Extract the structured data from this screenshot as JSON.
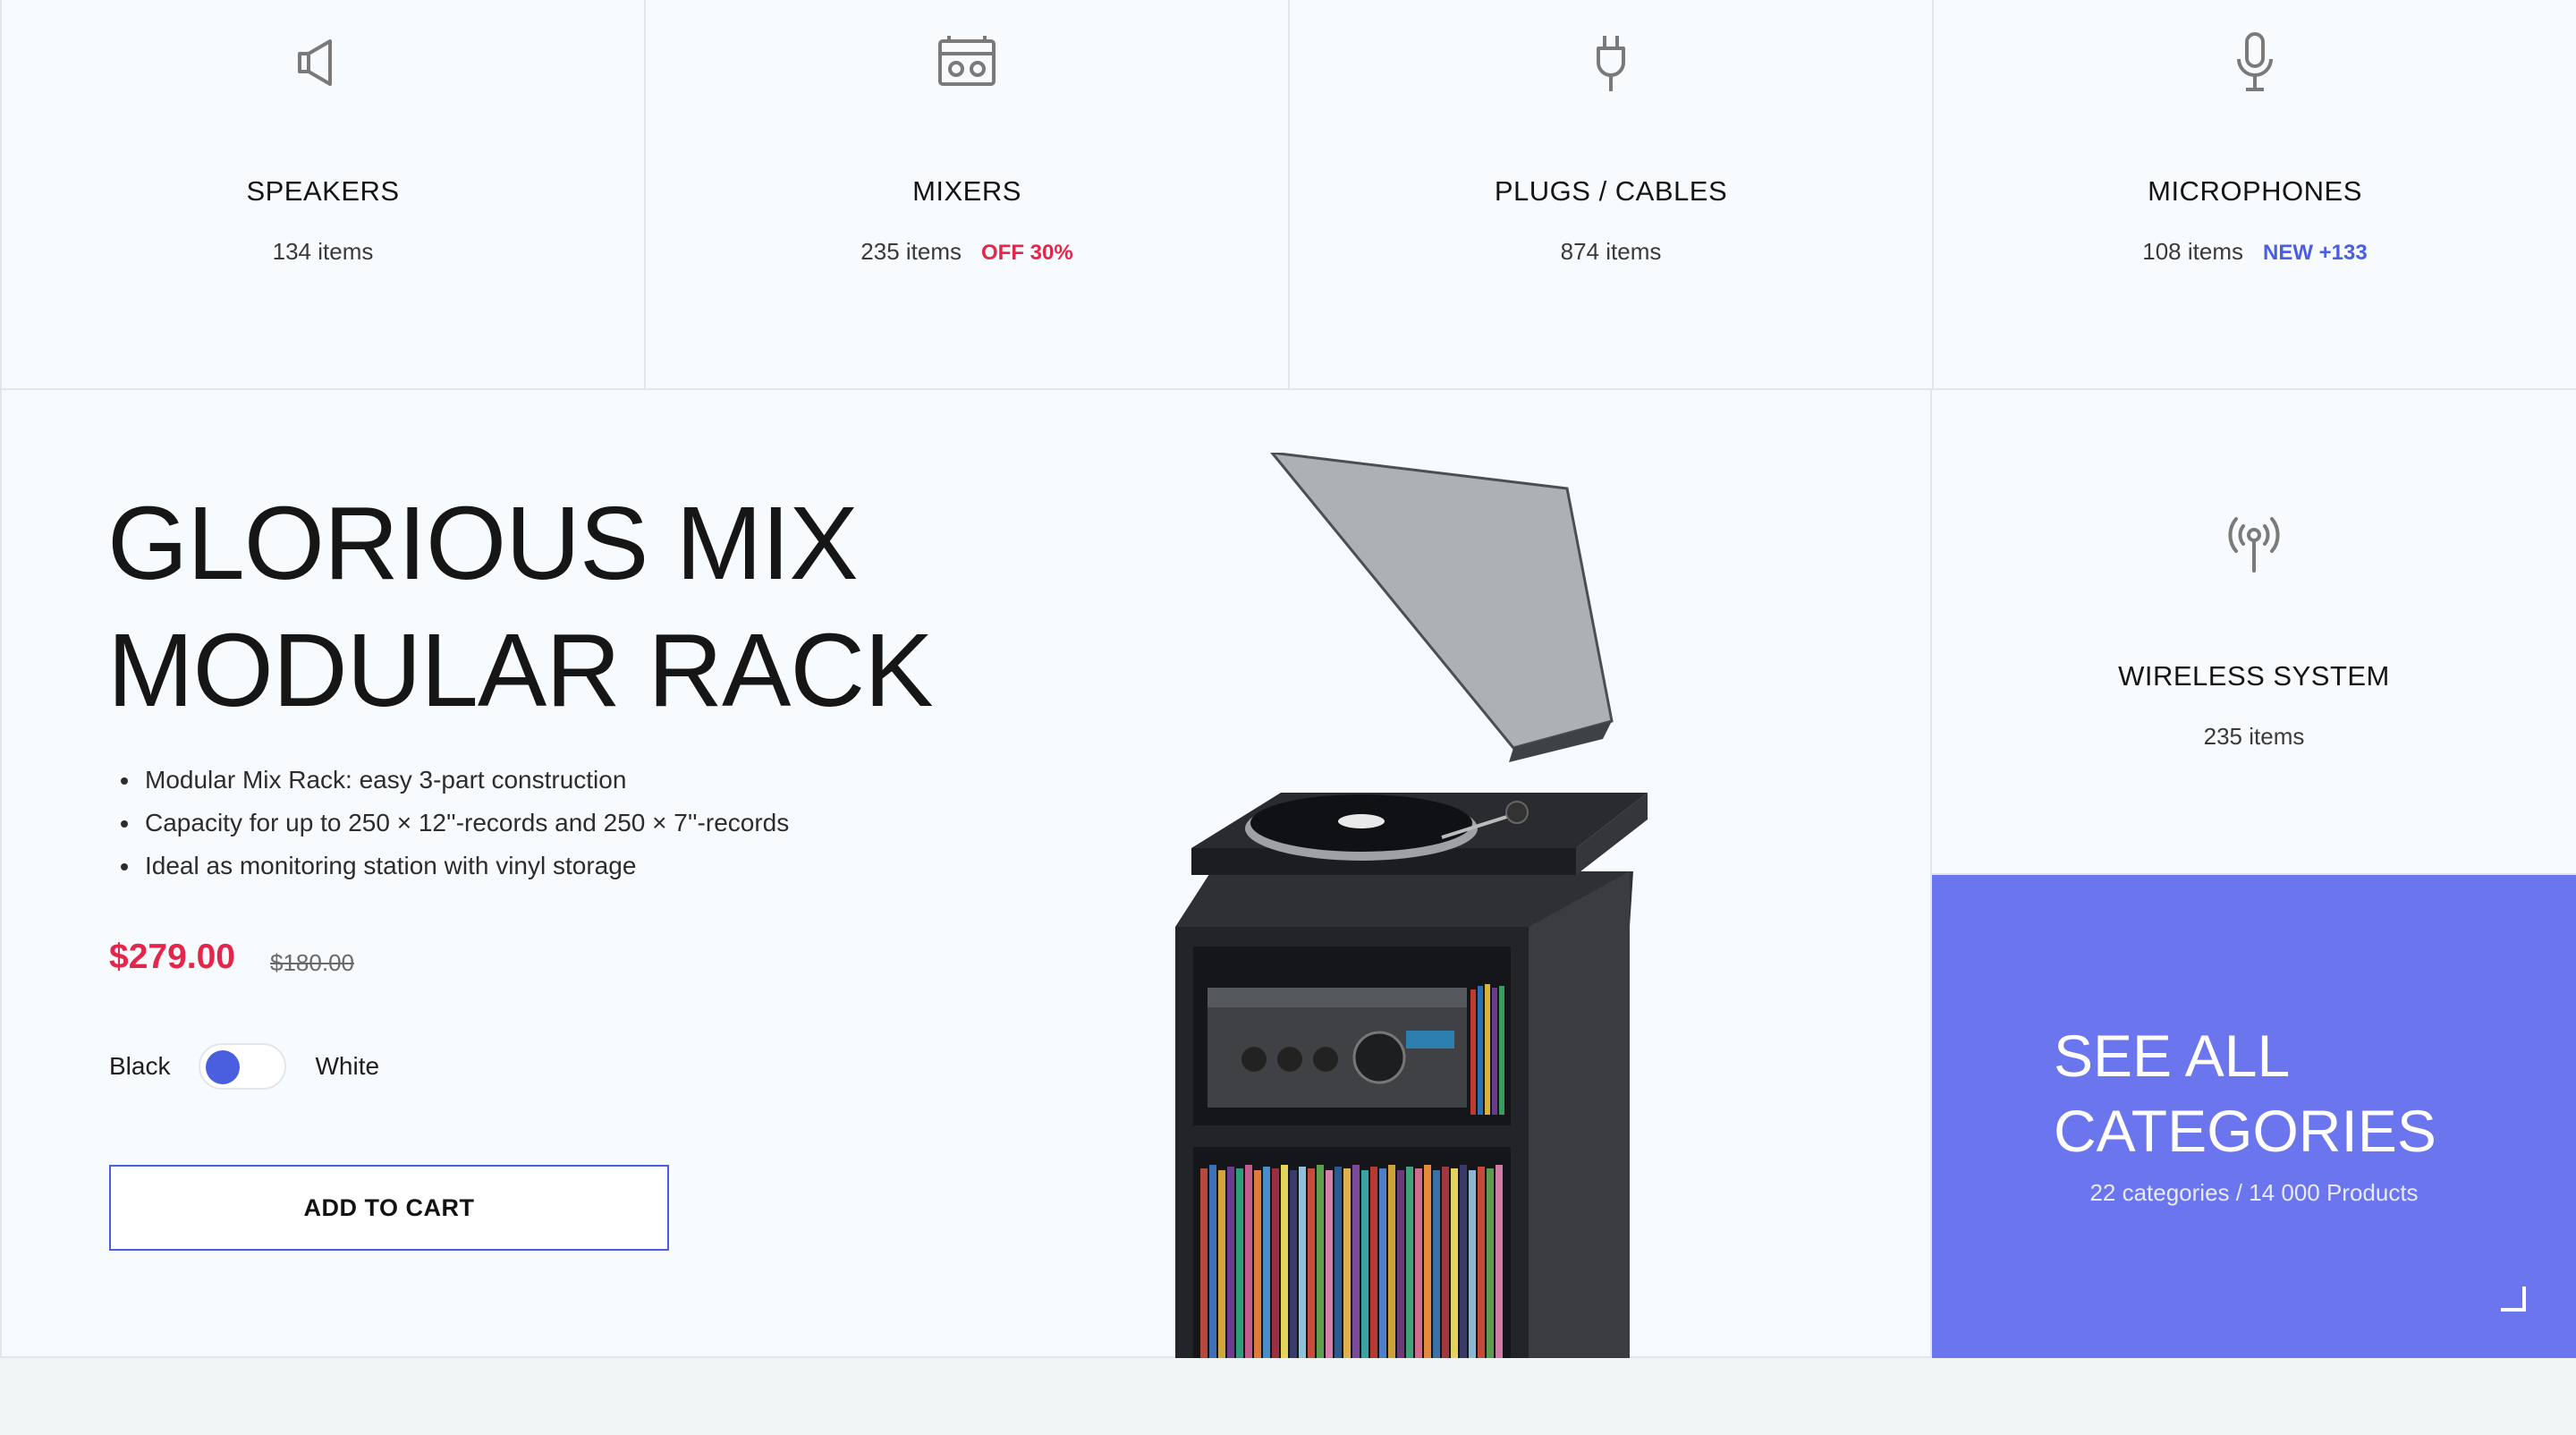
{
  "categories": [
    {
      "name": "SPEAKERS",
      "count": "134 items",
      "tag": "",
      "icon": "megaphone-icon"
    },
    {
      "name": "MIXERS",
      "count": "235 items",
      "tag": "OFF 30%",
      "icon": "boombox-icon"
    },
    {
      "name": "PLUGS / CABLES",
      "count": "874 items",
      "tag": "",
      "icon": "plug-icon"
    },
    {
      "name": "MICROPHONES",
      "count": "108 items",
      "tag": "NEW +133",
      "icon": "microphone-icon"
    }
  ],
  "hero": {
    "title_line1": "GLORIOUS MIX",
    "title_line2": "MODULAR RACK",
    "bullets": [
      "Modular Mix Rack: easy 3-part construction",
      "Capacity for up to 250 × 12''-records and 250 × 7''-records",
      "Ideal as monitoring station with vinyl storage"
    ],
    "price": "$279.00",
    "old_price": "$180.00",
    "color_left": "Black",
    "color_right": "White",
    "add_to_cart": "ADD TO CART"
  },
  "wireless": {
    "name": "WIRELESS SYSTEM",
    "count": "235 items",
    "icon": "antenna-icon"
  },
  "see_all": {
    "title_line1": "SEE ALL",
    "title_line2": "CATEGORIES",
    "subtitle": "22 categories / 14 000 Products"
  },
  "colors": {
    "accent": "#4a5ee0",
    "sale": "#e5264b",
    "panel": "#6b75ee"
  }
}
